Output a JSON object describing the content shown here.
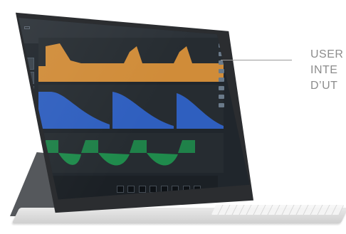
{
  "callout": {
    "lines": [
      "USER",
      "INTE",
      "D’UT"
    ]
  },
  "screen": {
    "panels": [
      {
        "name": "orange-waveform",
        "color": "#d9913a"
      },
      {
        "name": "blue-waveform",
        "color": "#2f5fbf"
      },
      {
        "name": "green-waveform",
        "color": "#1f8b4c"
      }
    ],
    "transport_pad_count": 8
  }
}
